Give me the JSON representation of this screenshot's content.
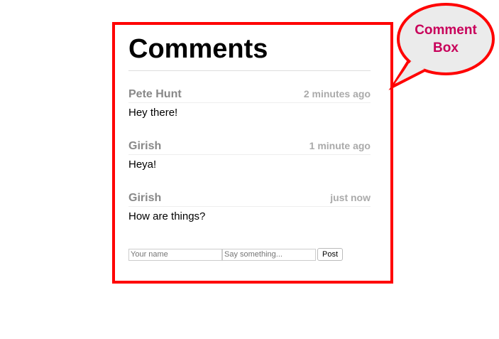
{
  "title": "Comments",
  "comments": [
    {
      "author": "Pete Hunt",
      "time": "2 minutes ago",
      "text": "Hey there!"
    },
    {
      "author": "Girish",
      "time": "1 minute ago",
      "text": "Heya!"
    },
    {
      "author": "Girish",
      "time": "just now",
      "text": "How are things?"
    }
  ],
  "form": {
    "name_placeholder": "Your name",
    "text_placeholder": "Say something...",
    "post_label": "Post"
  },
  "callout": {
    "line1": "Comment",
    "line2": "Box"
  },
  "colors": {
    "frame": "#ff0000",
    "callout_text": "#c8005a",
    "callout_fill": "#ebebeb"
  }
}
